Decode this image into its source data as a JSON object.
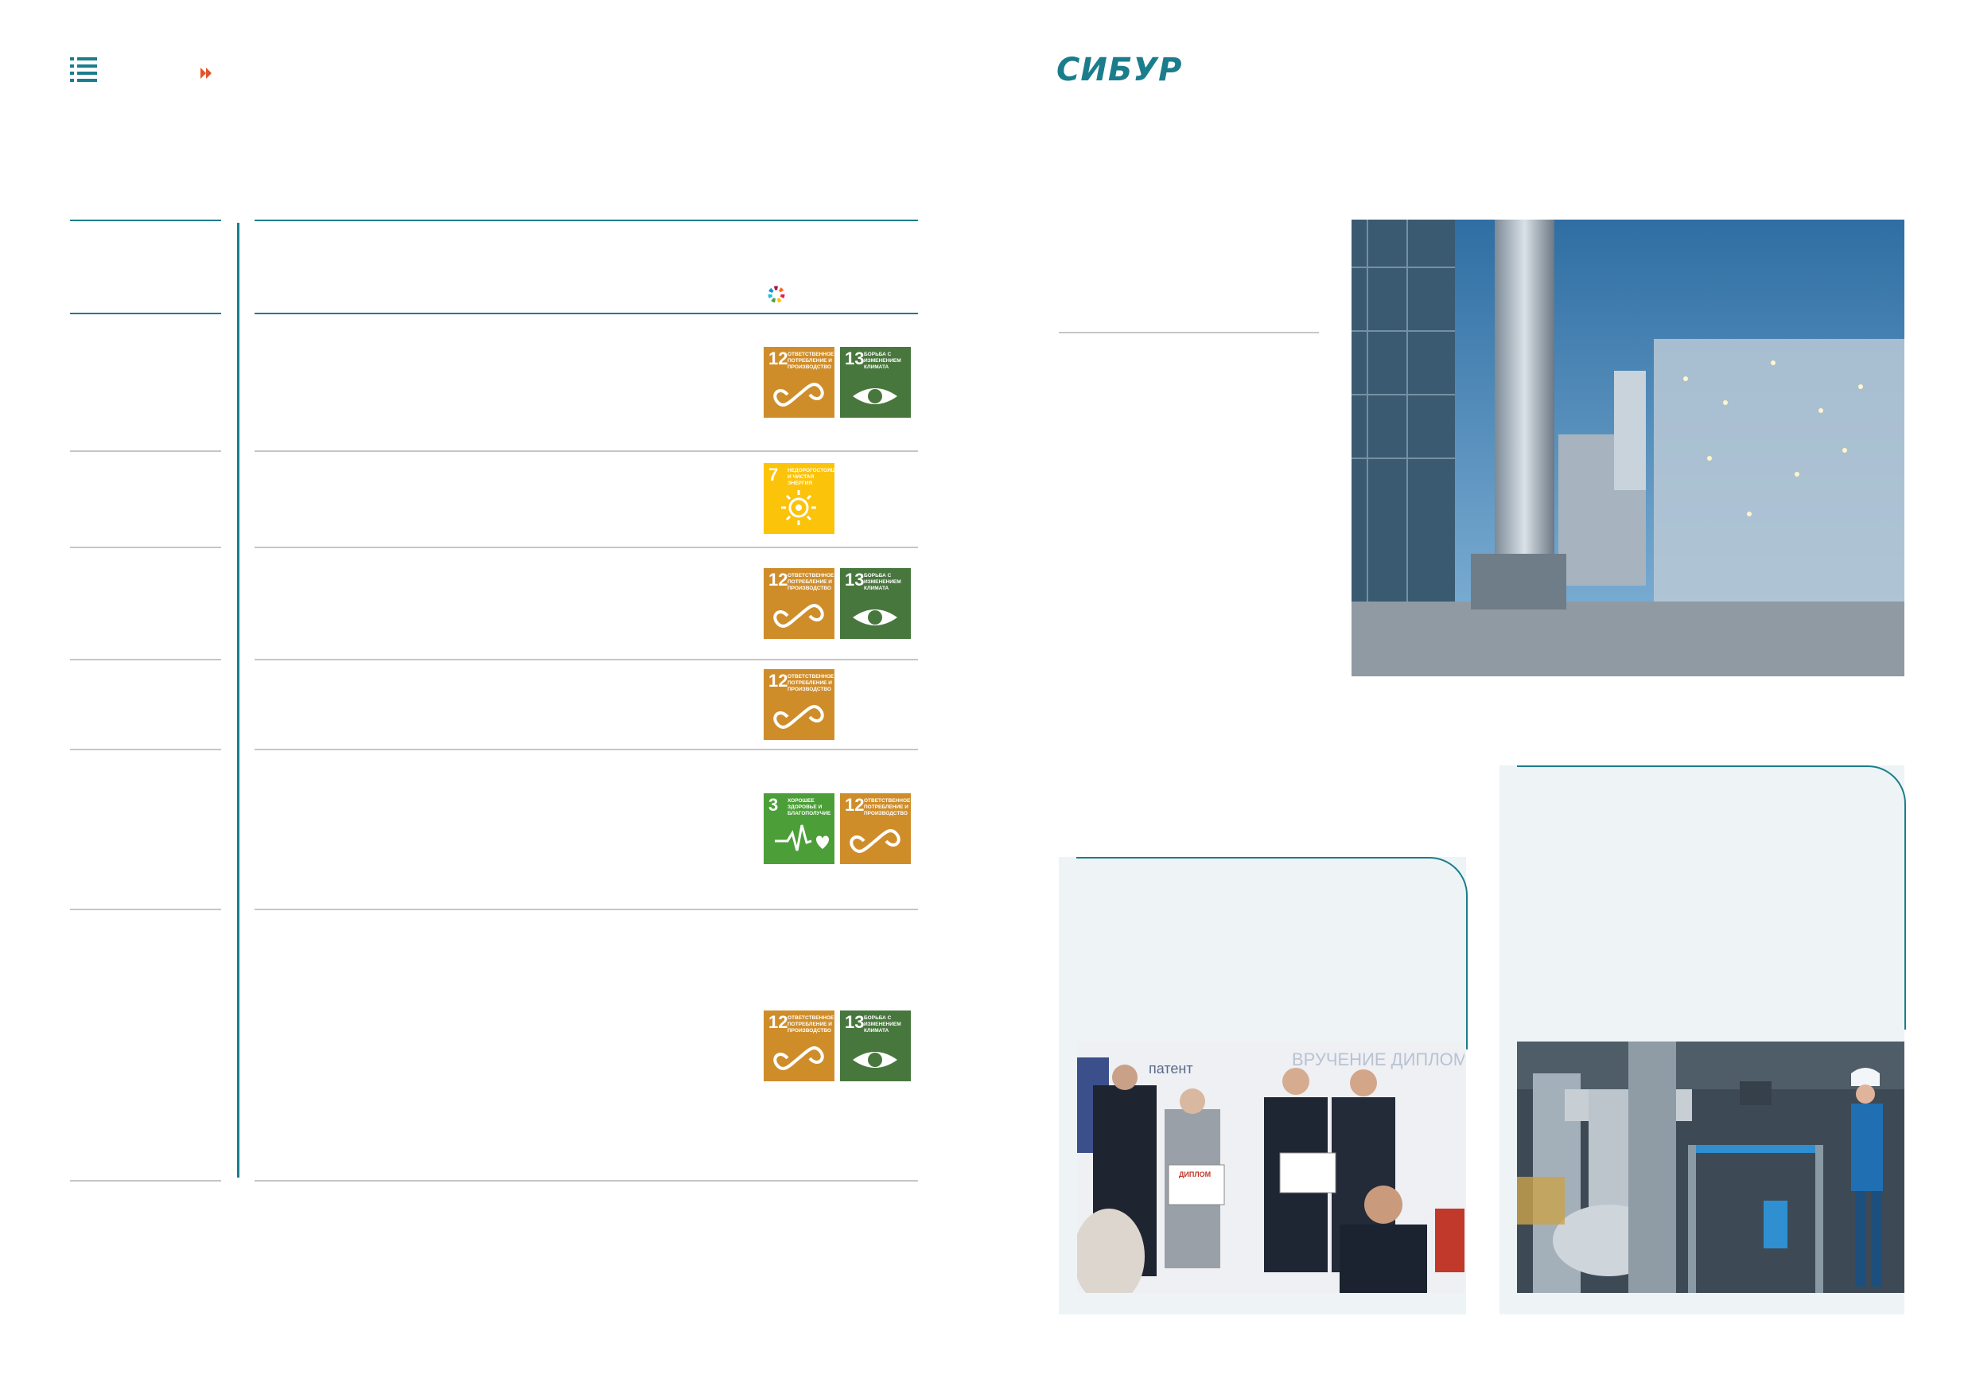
{
  "header": {
    "logo_text": "СИБУР",
    "menu_icon": "list-menu-icon",
    "next_icon": "double-chevron-right-icon"
  },
  "colors": {
    "accent": "#1b7d8c",
    "next_arrow": "#e0542a",
    "sdg_12": "#cf8d2a",
    "sdg_13": "#48773e",
    "sdg_7": "#fcc30b",
    "sdg_3": "#4c9f38",
    "card_background": "#eef4f6"
  },
  "table": {
    "sdg_wheel_icon": "sdg-color-wheel-icon",
    "rows": [
      {
        "goals": [
          {
            "number": "12",
            "text": "Ответственное потребление и производство",
            "icon": "infinity-icon"
          },
          {
            "number": "13",
            "text": "Борьба с изменением климата",
            "icon": "eye-globe-icon"
          }
        ]
      },
      {
        "goals": [
          {
            "number": "7",
            "text": "Недорогостоящая и чистая энергия",
            "icon": "sun-power-icon"
          }
        ]
      },
      {
        "goals": [
          {
            "number": "12",
            "text": "Ответственное потребление и производство",
            "icon": "infinity-icon"
          },
          {
            "number": "13",
            "text": "Борьба с изменением климата",
            "icon": "eye-globe-icon"
          }
        ]
      },
      {
        "goals": [
          {
            "number": "12",
            "text": "Ответственное потребление и производство",
            "icon": "infinity-icon"
          }
        ]
      },
      {
        "goals": [
          {
            "number": "3",
            "text": "Хорошее здоровье и благополучие",
            "icon": "heartbeat-icon"
          },
          {
            "number": "12",
            "text": "Ответственное потребление и производство",
            "icon": "infinity-icon"
          }
        ]
      },
      {
        "goals": [
          {
            "number": "12",
            "text": "Ответственное потребление и производство",
            "icon": "infinity-icon"
          },
          {
            "number": "13",
            "text": "Борьба с изменением климата",
            "icon": "eye-globe-icon"
          }
        ]
      }
    ]
  },
  "photos": {
    "plant": {
      "subject": "petrochemical-plant-photo"
    },
    "award": {
      "subject": "award-ceremony-photo",
      "banner_text": "ВРУЧЕНИЕ ДИПЛОМ ЕРАМ ОБЩЕСТВ",
      "sign_text": "патент",
      "diploma_label": "ДИПЛОМ"
    },
    "worker": {
      "subject": "plant-worker-photo"
    }
  }
}
